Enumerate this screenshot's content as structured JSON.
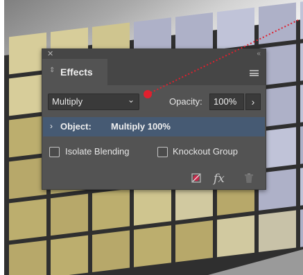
{
  "panel": {
    "tab_label": "Effects",
    "blend_mode": "Multiply",
    "opacity_label": "Opacity:",
    "opacity_value": "100%",
    "object_label": "Object:",
    "object_value": "Multiply 100%",
    "isolate_label": "Isolate Blending",
    "isolate_checked": false,
    "knockout_label": "Knockout Group",
    "knockout_checked": false,
    "fx_label": "fx"
  },
  "colors": {
    "panel_bg": "#535353",
    "selected_row": "#465a73",
    "annotation_red": "#e0202e"
  }
}
